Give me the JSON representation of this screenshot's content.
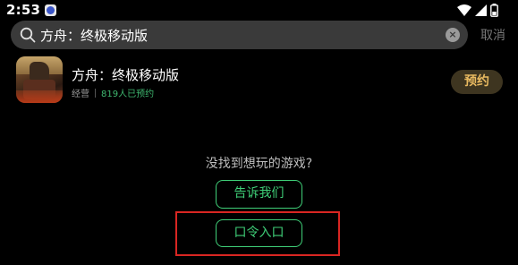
{
  "status_bar": {
    "time": "2:53",
    "icons": [
      "app-notification-icon",
      "wifi-icon",
      "signal-icon",
      "battery-icon"
    ]
  },
  "search": {
    "query": "方舟：终极移动版",
    "cancel_label": "取消"
  },
  "result": {
    "title": "方舟：终极移动版",
    "category": "经营",
    "reserve_count": "819人已预约",
    "reserve_label": "预约"
  },
  "empty_state": {
    "prompt": "没找到想玩的游戏?",
    "tell_us_label": "告诉我们",
    "password_entry_label": "口令入口"
  },
  "colors": {
    "background": "#000000",
    "accent_green": "#3fcf78",
    "reserve_gold": "#e8b960",
    "highlight_red": "#d92622"
  }
}
